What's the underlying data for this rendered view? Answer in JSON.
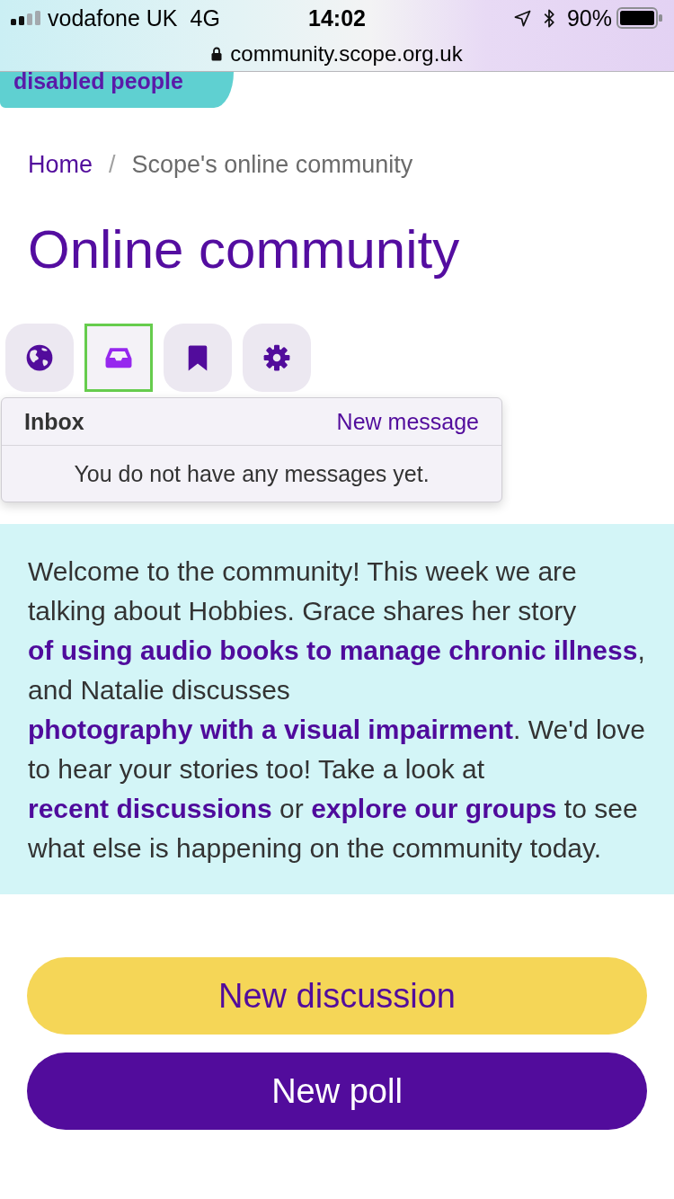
{
  "status_bar": {
    "carrier": "vodafone UK",
    "network": "4G",
    "time": "14:02",
    "battery": "90%"
  },
  "address_bar": {
    "url": "community.scope.org.uk"
  },
  "logo": {
    "text": "disabled people"
  },
  "breadcrumb": [
    {
      "label": "Home",
      "kind": "link"
    },
    {
      "label": "/",
      "kind": "separator"
    },
    {
      "label": "Scope's online community",
      "kind": "current"
    }
  ],
  "page_title": "Online community",
  "toolbar": [
    {
      "selected": false
    },
    {
      "selected": true
    },
    {
      "selected": false
    },
    {
      "selected": false
    }
  ],
  "inbox_menu": {
    "title": "Inbox",
    "action": "New message",
    "empty_message": "You do not have any messages yet."
  },
  "welcome": {
    "segments": [
      {
        "kind": "text",
        "text": "Welcome to the community! This week we are talking about Hobbies. Grace shares her story "
      },
      {
        "kind": "link",
        "text": "of using audio books to manage chronic illness"
      },
      {
        "kind": "text",
        "text": ", and Natalie discusses "
      },
      {
        "kind": "link",
        "text": "photography with a visual impairment"
      },
      {
        "kind": "text",
        "text": ". We'd love to hear your stories too! Take a look at "
      },
      {
        "kind": "link",
        "text": "recent discussions"
      },
      {
        "kind": "text",
        "text": " or "
      },
      {
        "kind": "link",
        "text": "explore our groups"
      },
      {
        "kind": "text",
        "text": " to see what else is happening on the community today."
      }
    ]
  },
  "buttons": [
    {
      "label": "New discussion",
      "kind": "secondary"
    },
    {
      "label": "New poll",
      "kind": "primary"
    }
  ]
}
